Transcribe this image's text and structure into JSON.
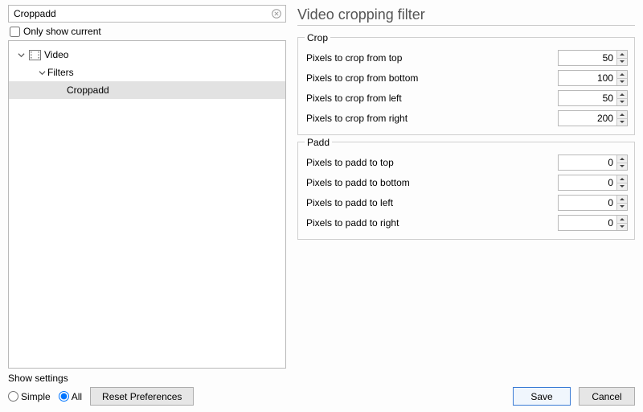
{
  "search": {
    "value": "Croppadd"
  },
  "only_show_current": {
    "label": "Only show current",
    "checked": false
  },
  "tree": {
    "video": "Video",
    "filters": "Filters",
    "croppadd": "Croppadd"
  },
  "right": {
    "title": "Video cropping filter",
    "crop": {
      "legend": "Crop",
      "top": {
        "label": "Pixels to crop from top",
        "value": "50"
      },
      "bottom": {
        "label": "Pixels to crop from bottom",
        "value": "100"
      },
      "left": {
        "label": "Pixels to crop from left",
        "value": "50"
      },
      "right": {
        "label": "Pixels to crop from right",
        "value": "200"
      }
    },
    "padd": {
      "legend": "Padd",
      "top": {
        "label": "Pixels to padd to top",
        "value": "0"
      },
      "bottom": {
        "label": "Pixels to padd to bottom",
        "value": "0"
      },
      "left": {
        "label": "Pixels to padd to left",
        "value": "0"
      },
      "right": {
        "label": "Pixels to padd to right",
        "value": "0"
      }
    }
  },
  "footer": {
    "show_settings_label": "Show settings",
    "simple": "Simple",
    "all": "All",
    "reset": "Reset Preferences",
    "save": "Save",
    "cancel": "Cancel"
  }
}
